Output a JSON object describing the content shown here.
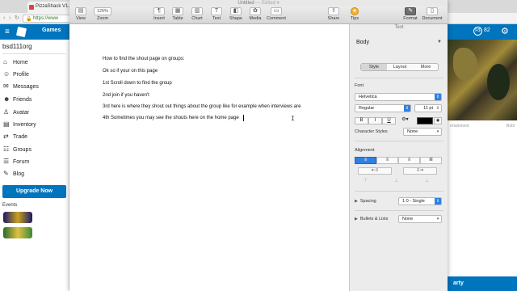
{
  "browser": {
    "tab_title": "PizzaShack V1.8",
    "address": "https://www",
    "back": "‹",
    "forward": "›",
    "reload": "↻"
  },
  "site": {
    "menu_icon": "≡",
    "nav_games": "Games",
    "robux_icon": "R$",
    "robux_count": "82",
    "gear_icon": "⚙",
    "username": "bsd111org",
    "sidebar": [
      {
        "label": "Home",
        "icon": "⌂"
      },
      {
        "label": "Profile",
        "icon": "☺"
      },
      {
        "label": "Messages",
        "icon": "✉"
      },
      {
        "label": "Friends",
        "icon": "☻"
      },
      {
        "label": "Avatar",
        "icon": "♙"
      },
      {
        "label": "Inventory",
        "icon": "▤"
      },
      {
        "label": "Trade",
        "icon": "⇄"
      },
      {
        "label": "Groups",
        "icon": "☷"
      },
      {
        "label": "Forum",
        "icon": "☰"
      },
      {
        "label": "Blog",
        "icon": "✎"
      }
    ],
    "upgrade_label": "Upgrade Now",
    "events_label": "Events",
    "right_caption_left": "ertainment",
    "right_caption_right": "Robl",
    "right_bottom_label": "arty"
  },
  "pages": {
    "title": "Untitled",
    "title_suffix": "— Edited ▾",
    "toolbar": {
      "view": "View",
      "zoom_value": "125%",
      "zoom": "Zoom",
      "insert": "Insert",
      "table": "Table",
      "chart": "Chart",
      "text": "Text",
      "shape": "Shape",
      "media": "Media",
      "comment": "Comment",
      "share": "Share",
      "tips": "Tips",
      "format": "Format",
      "document": "Document"
    },
    "document_lines": [
      "How to find the shout page on groups:",
      "Ok so if your on this page",
      "1st Scroll down to find the group",
      " 2nd join if you haven't",
      "3rd here is where they shout out things about the group like for example when interviews are",
      "4th Sometimes you may see the shouts here on the home page"
    ],
    "inspector": {
      "header": "Text",
      "paragraph_style": "Body",
      "tabs": [
        "Style",
        "Layout",
        "More"
      ],
      "active_tab": "Style",
      "font_label": "Font",
      "font_name": "Helvetica",
      "font_weight": "Regular",
      "font_size": "11 pt",
      "bold": "B",
      "italic": "I",
      "underline": "U",
      "text_color": "#000000",
      "char_styles_label": "Character Styles",
      "char_styles_value": "None",
      "alignment_label": "Alignment",
      "spacing_label": "Spacing",
      "spacing_value": "1.0 - Single",
      "bullets_label": "Bullets & Lists",
      "bullets_value": "None"
    }
  },
  "colors": {
    "accent": "#2f80e4",
    "site_blue": "#0074bd"
  }
}
